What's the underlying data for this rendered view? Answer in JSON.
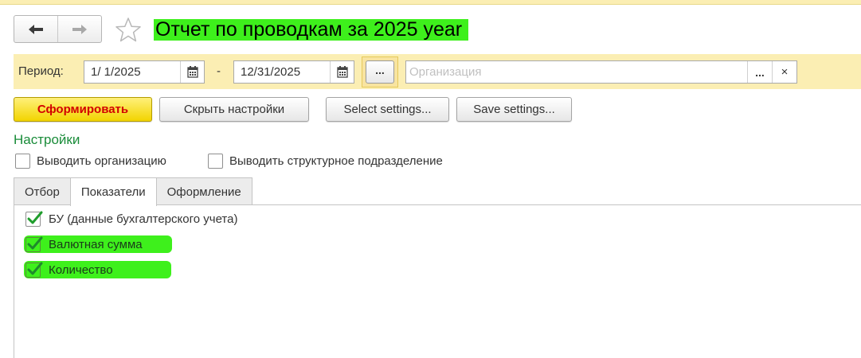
{
  "header": {
    "back_icon": "arrow-left-icon",
    "forward_icon": "arrow-right-icon",
    "favorite_icon": "star-icon",
    "title": "Отчет по проводкам  за 2025 year"
  },
  "period": {
    "label": "Период:",
    "start": "1/ 1/2025",
    "separator": "-",
    "end": "12/31/2025",
    "ellipsis_label": "...",
    "organization_placeholder": "Организация",
    "organization_value": "",
    "org_select_label": "...",
    "org_clear_label": "×"
  },
  "toolbar": {
    "generate_label": "Сформировать",
    "hide_settings_label": "Скрыть настройки",
    "select_settings_label": "Select settings...",
    "save_settings_label": "Save settings..."
  },
  "settings": {
    "title": "Настройки",
    "show_organization": {
      "label": "Выводить организацию",
      "checked": false
    },
    "show_subdivision": {
      "label": "Выводить структурное подразделение",
      "checked": false
    }
  },
  "tabs": [
    {
      "label": "Отбор",
      "active": false
    },
    {
      "label": "Показатели",
      "active": true
    },
    {
      "label": "Оформление",
      "active": false
    }
  ],
  "indicators": [
    {
      "label": "БУ (данные бухгалтерского учета)",
      "checked": true
    },
    {
      "label": "Валютная сумма",
      "checked": true
    },
    {
      "label": "Количество",
      "checked": true
    }
  ],
  "colors": {
    "highlight": "#3ef01c",
    "accent_green": "#1a8c3a",
    "primary_button": "#f2d400",
    "primary_text": "#d20000",
    "period_bar": "#fbeeb3"
  }
}
